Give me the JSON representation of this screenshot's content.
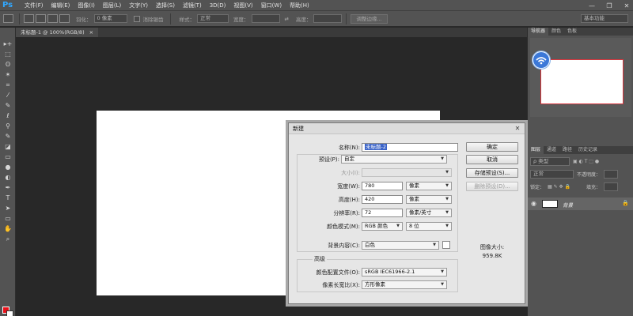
{
  "app": {
    "logo": "Ps"
  },
  "menu": [
    "文件(F)",
    "编辑(E)",
    "图像(I)",
    "图层(L)",
    "文字(Y)",
    "选择(S)",
    "滤镜(T)",
    "3D(D)",
    "视图(V)",
    "窗口(W)",
    "帮助(H)"
  ],
  "window_controls": {
    "minimize": "—",
    "restore": "❐",
    "close": "✕"
  },
  "options_bar": {
    "feather_label": "羽化：",
    "feather_value": "0 像素",
    "antialias_label": "消除锯齿",
    "style_label": "样式：",
    "style_value": "正常",
    "width_label": "宽度：",
    "swap_icon": "⇄",
    "height_label": "高度：",
    "refine_button": "调整边缘...",
    "workspace": "基本功能"
  },
  "document": {
    "tab_label": "未标题-1 @ 100%(RGB/8)",
    "close": "×"
  },
  "tools": [
    "▸+",
    "⬚",
    "ʘ",
    "✶",
    "⌗",
    "⁄",
    "✎",
    "ℓ",
    "⚲",
    "✎",
    "◪",
    "▭",
    "●",
    "◐",
    "✒",
    "T",
    "➤",
    "▭",
    "✋",
    "⌕"
  ],
  "colors": {
    "foreground": "#e8111a",
    "background": "#ffffff",
    "accent": "#3a63c8"
  },
  "right_panel": {
    "nav_tabs": [
      "导航器",
      "颜色",
      "色板"
    ],
    "layers_tabs": [
      "图层",
      "通道",
      "路径",
      "历史记录"
    ],
    "kind_label": "ρ 类型",
    "blend_mode": "正常",
    "opacity_label": "不透明度：",
    "lock_label": "锁定：",
    "fill_label": "填充：",
    "layer_name": "背景"
  },
  "dialog": {
    "title": "新建",
    "name_label": "名称(N):",
    "name_value": "未标题-2",
    "preset_label": "预设(P):",
    "preset_value": "自定",
    "size_label": "大小(I):",
    "width_label": "宽度(W):",
    "width_value": "780",
    "width_unit": "像素",
    "height_label": "高度(H):",
    "height_value": "420",
    "height_unit": "像素",
    "resolution_label": "分辨率(R):",
    "resolution_value": "72",
    "resolution_unit": "像素/英寸",
    "color_mode_label": "颜色模式(M):",
    "color_mode_value": "RGB 颜色",
    "bit_depth": "8 位",
    "bg_label": "背景内容(C):",
    "bg_value": "白色",
    "advanced_label": "高级",
    "profile_label": "颜色配置文件(O):",
    "profile_value": "sRGB IEC61966-2.1",
    "pixel_aspect_label": "像素长宽比(X):",
    "pixel_aspect_value": "方形像素",
    "ok": "确定",
    "cancel": "取消",
    "save_preset": "存储预设(S)...",
    "delete_preset": "删除预设(D)...",
    "image_size_label": "图像大小:",
    "image_size_value": "959.8K"
  }
}
